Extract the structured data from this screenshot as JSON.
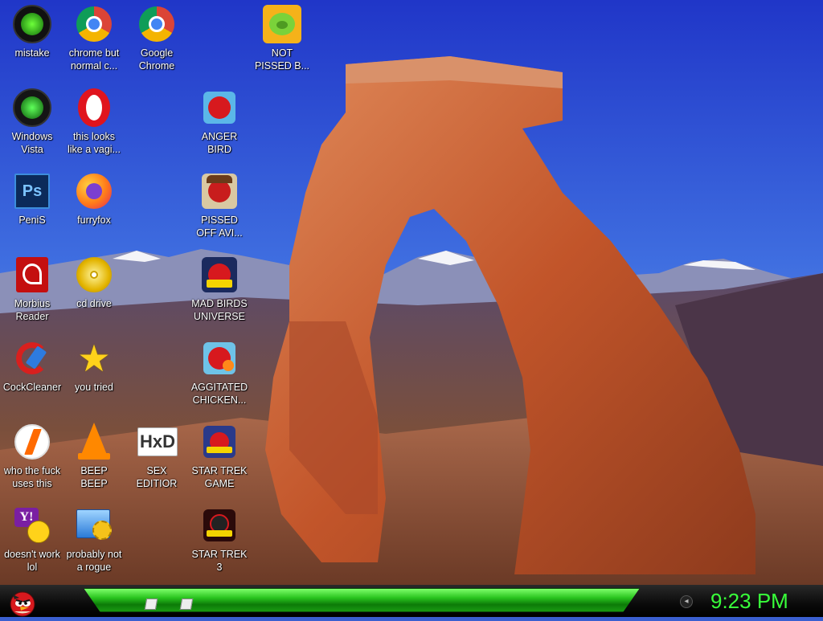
{
  "desktop": {
    "icons": [
      {
        "label": "mistake",
        "icon": "razer-icon"
      },
      {
        "label": "chrome but\nnormal c...",
        "icon": "chrome-icon"
      },
      {
        "label": "Google\nChrome",
        "icon": "chrome-icon"
      },
      {
        "label": "NOT\nPISSED B...",
        "icon": "bad-piggies-icon"
      },
      {
        "label": "Windows\nVista",
        "icon": "recycle-bin-icon"
      },
      {
        "label": "this looks\nlike a vagi...",
        "icon": "opera-icon"
      },
      {
        "label": "ANGER\nBIRD",
        "icon": "angry-birds-icon"
      },
      {
        "label": "PeniS",
        "icon": "photoshop-icon"
      },
      {
        "label": "furryfox",
        "icon": "firefox-icon"
      },
      {
        "label": "PISSED\nOFF AVI...",
        "icon": "angry-birds-seasons-icon"
      },
      {
        "label": "Morbius\nReader",
        "icon": "adobe-reader-icon"
      },
      {
        "label": "cd drive",
        "icon": "cd-icon"
      },
      {
        "label": "MAD BIRDS\nUNIVERSE",
        "icon": "angry-birds-space-icon"
      },
      {
        "label": "CockCleaner",
        "icon": "ccleaner-icon"
      },
      {
        "label": "you tried",
        "icon": "star-icon"
      },
      {
        "label": "AGGITATED\nCHICKEN...",
        "icon": "angry-birds-rio-icon"
      },
      {
        "label": "who the fuck\nuses this",
        "icon": "winamp-icon"
      },
      {
        "label": "BEEP\nBEEP",
        "icon": "vlc-icon"
      },
      {
        "label": "SEX\nEDITIOR",
        "icon": "hxd-icon"
      },
      {
        "label": "STAR TREK\nGAME",
        "icon": "angry-birds-star-wars-icon"
      },
      {
        "label": "doesn't work\nlol",
        "icon": "yahoo-messenger-icon"
      },
      {
        "label": "probably not\na rogue",
        "icon": "system-settings-icon"
      },
      {
        "label": "STAR TREK\n3",
        "icon": "angry-birds-star-wars-2-icon"
      }
    ]
  },
  "taskbar": {
    "start_icon": "angry-bird-start-icon",
    "clock": "9:23 PM",
    "tray_icon": "speaker-icon"
  },
  "colors": {
    "clock": "#38ff3a",
    "taskbar_accent": "#29c41e",
    "sky": "#2f4fd8"
  }
}
